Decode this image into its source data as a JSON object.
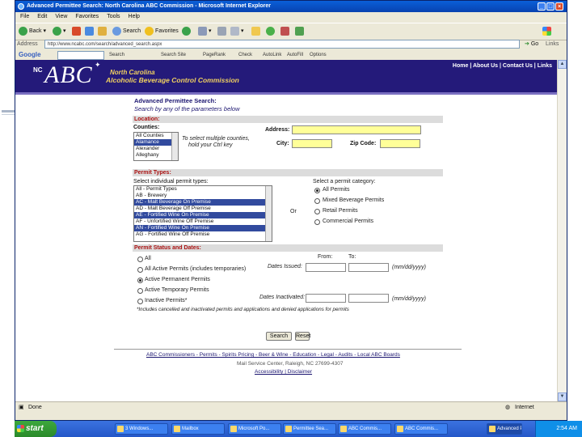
{
  "window": {
    "title": "Advanced Permittee Search: North Carolina ABC Commission - Microsoft Internet Explorer",
    "menu": [
      "File",
      "Edit",
      "View",
      "Favorites",
      "Tools",
      "Help"
    ],
    "toolbar": {
      "back": "Back",
      "search": "Search",
      "favorites": "Favorites"
    },
    "address_label": "Address",
    "address": "http://www.ncabc.com/search/advanced_search.aspx",
    "go": "Go",
    "links": "Links",
    "google": {
      "logo": "Google",
      "items": [
        "Search",
        "Search Site",
        "PageRank",
        "Check",
        "AutoLink",
        "AutoFill",
        "Options"
      ]
    },
    "status": "Done",
    "zone": "Internet"
  },
  "site": {
    "nc": "NC",
    "logo": "ABC",
    "subtitle1": "North Carolina",
    "subtitle2": "Alcoholic Beverage Control Commission",
    "toplinks": "Home | About Us | Contact Us | Links"
  },
  "form": {
    "title": "Advanced Permittee Search:",
    "subtitle": "Search by any of the parameters below",
    "location": {
      "header": "Location:",
      "counties_label": "Counties:",
      "counties": [
        "All Counties",
        "Alamance",
        "Alexander",
        "Alleghany"
      ],
      "selected_county": 1,
      "hint_line1": "To select multiple counties,",
      "hint_line2": "hold your Ctrl key",
      "address_label": "Address:",
      "city_label": "City:",
      "zip_label": "Zip Code:"
    },
    "permit_types": {
      "header": "Permit Types:",
      "individual_label": "Select individual permit types:",
      "types": [
        "All - Permit Types",
        "AB - Brewery",
        "AC - Malt Beverage On Premise",
        "AD - Malt Beverage Off Premise",
        "AE - Fortified Wine On Premise",
        "AF - Unfortified Wine Off Premise",
        "AN - Fortified Wine On Premise",
        "AG - Fortified Wine Off Premise"
      ],
      "selected_types": [
        2,
        4,
        6
      ],
      "or": "Or",
      "category_label": "Select a permit category:",
      "categories": [
        "All Permits",
        "Mixed Beverage Permits",
        "Retail Permits",
        "Commercial Permits"
      ],
      "selected_category": 0
    },
    "status": {
      "header": "Permit Status and Dates:",
      "options": [
        "All",
        "All Active Permits (includes temporaries)",
        "Active Permanent Permits",
        "Active Temporary Permits",
        "Inactive Permits*"
      ],
      "selected": 2,
      "from_label": "From:",
      "to_label": "To:",
      "issued_label": "Dates Issued:",
      "inactivated_label": "Dates Inactivated:",
      "date_hint": "(mm/dd/yyyy)",
      "note": "*Includes cancelled and inactivated permits and applications and denied applications for permits"
    },
    "buttons": {
      "search": "Search",
      "reset": "Reset"
    }
  },
  "footer": {
    "links": "ABC Commissioners - Permits - Spirits Pricing - Beer & Wine - Education - Legal - Audits - Local ABC Boards",
    "line2": "Mail Service Center, Raleigh, NC 27699-4307",
    "line3": "Accessibility | Disclaimer"
  },
  "taskbar": {
    "start": "start",
    "tasks": [
      "3 Windows...",
      "Mailbox",
      "Microsoft Po...",
      "Permittee Sea...",
      "ABC Commis...",
      "ABC Commis...",
      "Advanced Perm..."
    ],
    "active_task": 6,
    "clock": "2:54 AM"
  }
}
